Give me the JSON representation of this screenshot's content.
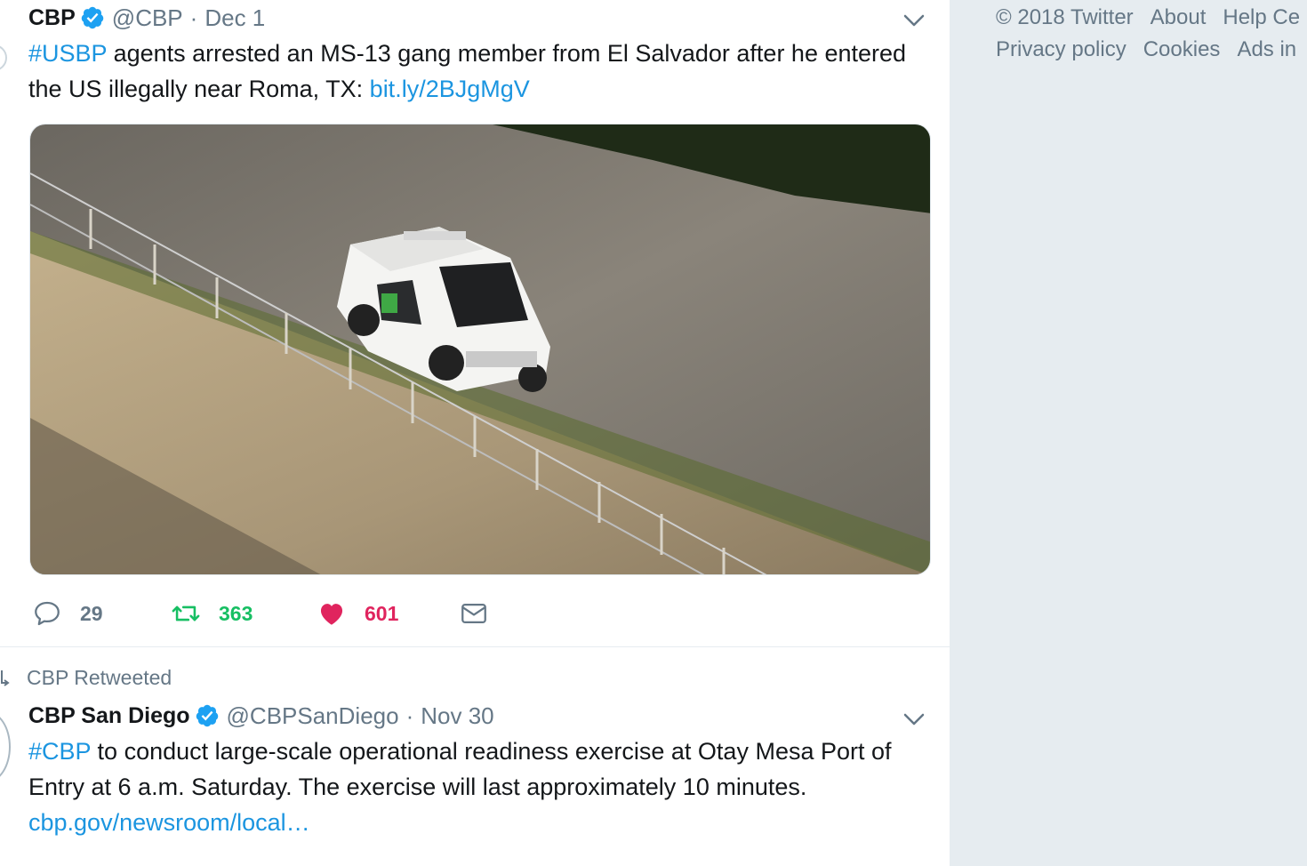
{
  "footer": {
    "row1": [
      "© 2018 Twitter",
      "About",
      "Help Ce"
    ],
    "row2": [
      "Privacy policy",
      "Cookies",
      "Ads in"
    ]
  },
  "tweet1": {
    "name": "CBP",
    "handle": "@CBP",
    "separator": "·",
    "date": "Dec 1",
    "hashtag": "#USBP",
    "text_main": " agents arrested an MS-13 gang member from El Salvador after he entered the US illegally near Roma, TX: ",
    "link": "bit.ly/2BJgMgV",
    "image_alt": "Border Patrol vehicle on a levee road beside a fence",
    "actions": {
      "replies": "29",
      "retweets": "363",
      "likes": "601"
    },
    "colors": {
      "retweet": "#17bf63",
      "like": "#e0245e",
      "link": "#1b95e0",
      "muted": "#657786"
    }
  },
  "retweet_label": "CBP Retweeted",
  "tweet2": {
    "name": "CBP San Diego",
    "handle": "@CBPSanDiego",
    "separator": "·",
    "date": "Nov 30",
    "hashtag": "#CBP",
    "text_main": " to conduct large-scale operational readiness exercise at Otay Mesa Port of Entry at 6 a.m. Saturday. The exercise will last approximately 10 minutes.",
    "link": "cbp.gov/newsroom/local…"
  }
}
